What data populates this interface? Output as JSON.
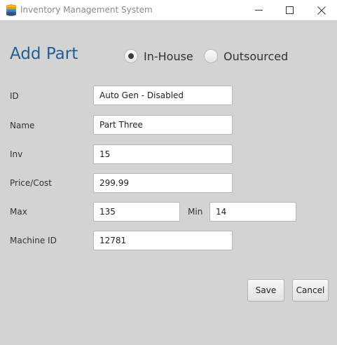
{
  "window": {
    "title": "Inventory Management System"
  },
  "icons": {
    "app": "database-icon",
    "minimize": "minimize-icon",
    "maximize": "maximize-icon",
    "close": "close-icon"
  },
  "form": {
    "heading": "Add Part",
    "source_options": [
      {
        "label": "In-House",
        "selected": true
      },
      {
        "label": "Outsourced",
        "selected": false
      }
    ],
    "fields": {
      "id": {
        "label": "ID",
        "value": "Auto Gen - Disabled"
      },
      "name": {
        "label": "Name",
        "value": "Part Three"
      },
      "inv": {
        "label": "Inv",
        "value": "15"
      },
      "price": {
        "label": "Price/Cost",
        "value": "299.99"
      },
      "max": {
        "label": "Max",
        "value": "135"
      },
      "min": {
        "label": "Min",
        "value": "14"
      },
      "machine_id": {
        "label": "Machine ID",
        "value": "12781"
      }
    },
    "buttons": {
      "save": "Save",
      "cancel": "Cancel"
    }
  },
  "colors": {
    "heading": "#1f5f95",
    "background": "#d3d3d3"
  }
}
